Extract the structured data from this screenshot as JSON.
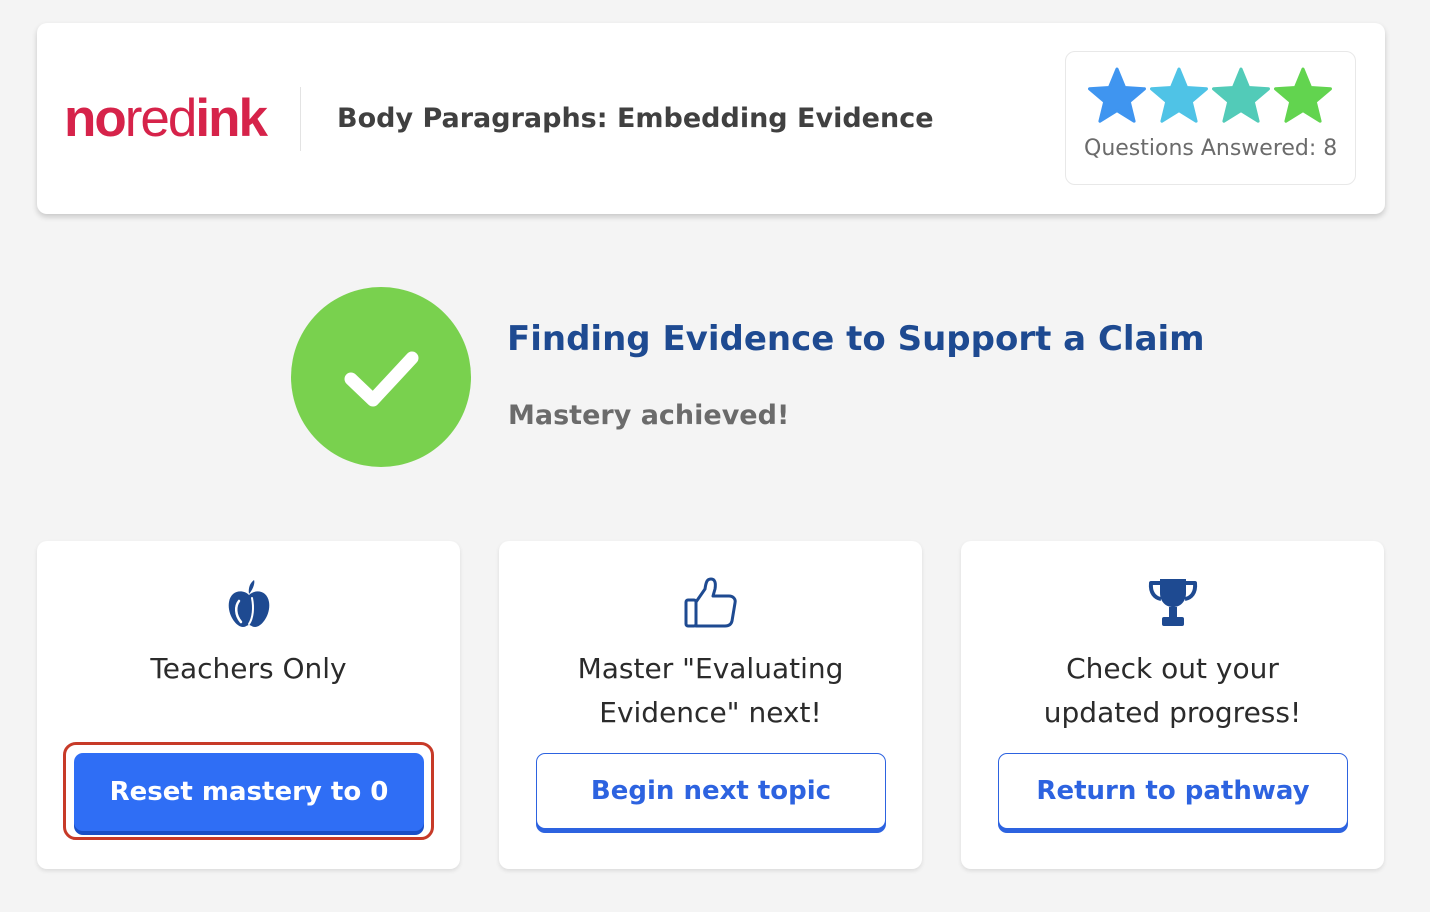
{
  "header": {
    "logo": {
      "part1": "no",
      "part2": "red",
      "part3": "ink"
    },
    "title": "Body Paragraphs: Embedding Evidence",
    "progress": {
      "stars_filled": 4,
      "stars_total": 4,
      "star_colors": [
        "#3f95f0",
        "#4fc3e6",
        "#52cbb8",
        "#62d44f"
      ],
      "questions_label": "Questions Answered: 8"
    }
  },
  "result": {
    "icon": "checkmark-icon",
    "circle_color": "#79d14e",
    "topic_title": "Finding Evidence to Support a Claim",
    "status": "Mastery achieved!"
  },
  "cards": [
    {
      "icon": "apple-icon",
      "text": "Teachers Only",
      "button_label": "Reset mastery to 0",
      "button_style": "primary",
      "highlighted": true
    },
    {
      "icon": "thumbs-up-icon",
      "text": "Master \"Evaluating Evidence\" next!",
      "button_label": "Begin next topic",
      "button_style": "secondary"
    },
    {
      "icon": "trophy-icon",
      "text": "Check out your updated progress!",
      "button_label": "Return to pathway",
      "button_style": "secondary"
    }
  ],
  "colors": {
    "brand_red": "#d6234a",
    "heading_navy": "#1e4a91",
    "button_blue": "#2f6ef5",
    "highlight_red": "#c73a28",
    "background": "#f4f4f4"
  }
}
